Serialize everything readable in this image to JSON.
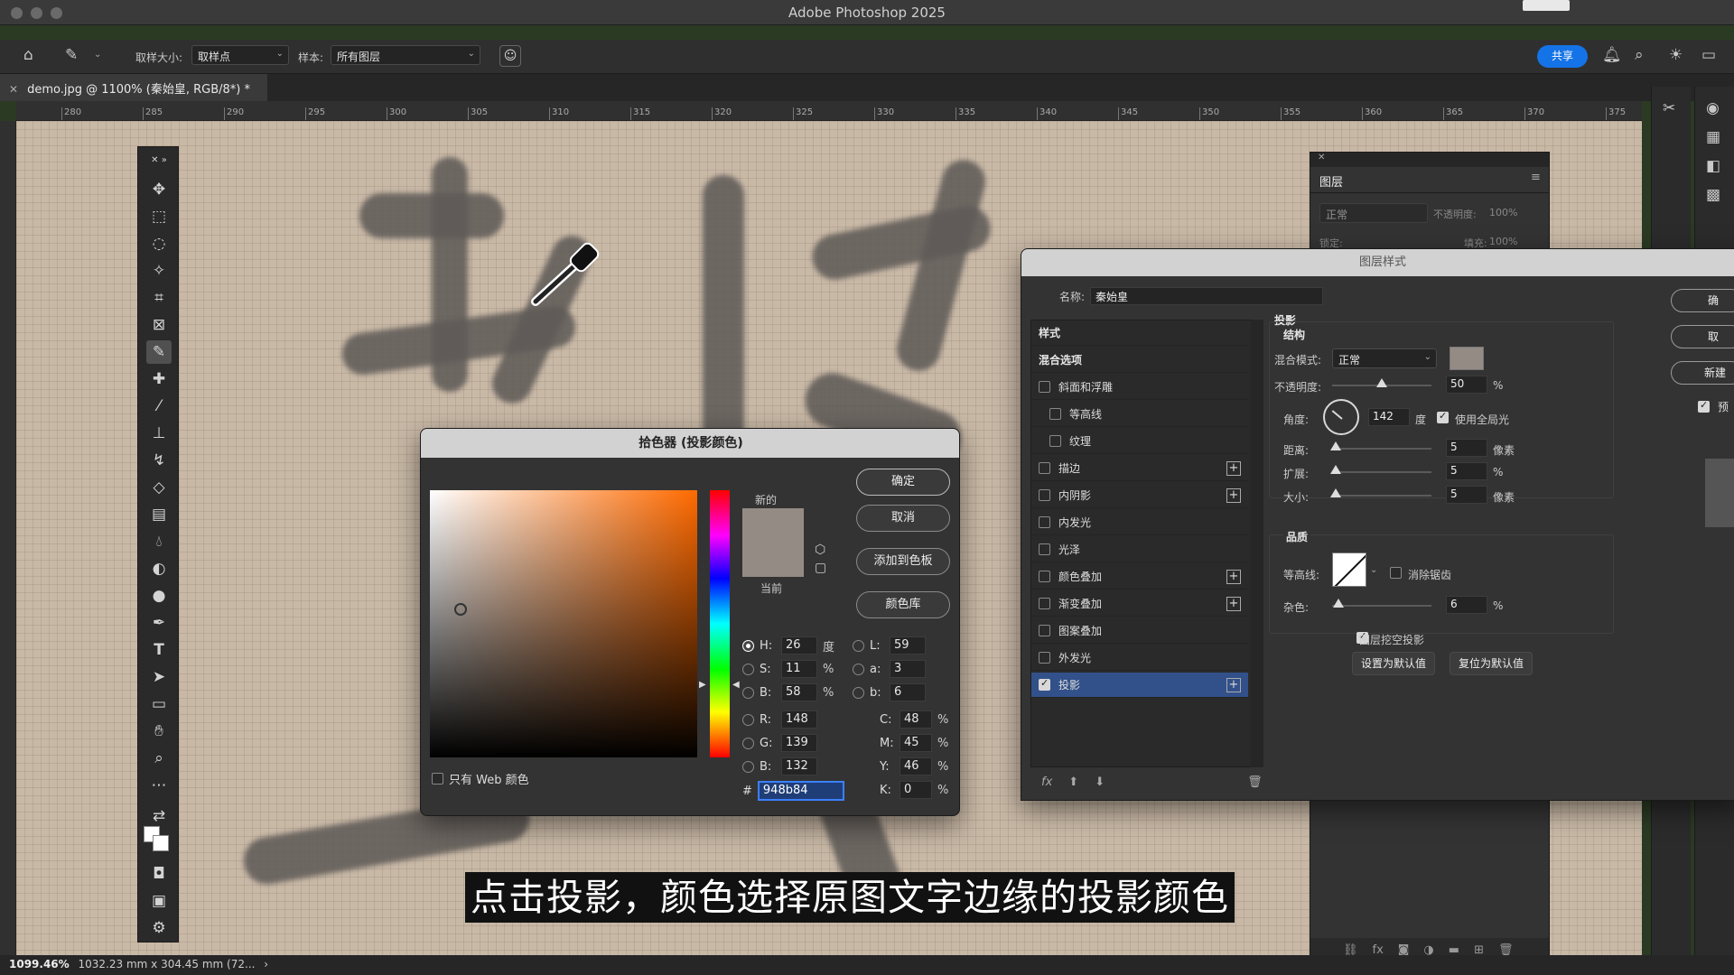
{
  "app": {
    "title": "Adobe Photoshop 2025"
  },
  "options_bar": {
    "sample_size_label": "取样大小:",
    "sample_size_value": "取样点",
    "sample_label": "样本:",
    "sample_value": "所有图层",
    "share_label": "共享"
  },
  "document": {
    "tab_title": "demo.jpg @ 1100% (秦始皇, RGB/8*) *",
    "ruler_ticks": [
      "280",
      "285",
      "290",
      "295",
      "300",
      "305",
      "310",
      "315",
      "320",
      "325",
      "330",
      "335",
      "340",
      "345",
      "350",
      "355",
      "360",
      "365",
      "370",
      "375"
    ]
  },
  "layers_panel": {
    "tab": "图层",
    "blend": "正常",
    "opacity_label": "不透明度:",
    "opacity_value": "100%",
    "lock_label": "锁定:",
    "fill_label": "填充:",
    "fill_value": "100%"
  },
  "color_picker": {
    "title": "拾色器 (投影颜色)",
    "new_label": "新的",
    "current_label": "当前",
    "new_color": "#948b84",
    "current_color": "#948b84",
    "buttons": {
      "ok": "确定",
      "cancel": "取消",
      "add_swatch": "添加到色板",
      "library": "颜色库"
    },
    "fields": {
      "H": {
        "label": "H:",
        "value": "26",
        "unit": "度"
      },
      "S": {
        "label": "S:",
        "value": "11",
        "unit": "%"
      },
      "B": {
        "label": "B:",
        "value": "58",
        "unit": "%"
      },
      "R": {
        "label": "R:",
        "value": "148"
      },
      "G": {
        "label": "G:",
        "value": "139"
      },
      "Bv": {
        "label": "B:",
        "value": "132"
      },
      "L": {
        "label": "L:",
        "value": "59"
      },
      "a": {
        "label": "a:",
        "value": "3"
      },
      "b": {
        "label": "b:",
        "value": "6"
      },
      "C": {
        "label": "C:",
        "value": "48",
        "unit": "%"
      },
      "M": {
        "label": "M:",
        "value": "45",
        "unit": "%"
      },
      "Y": {
        "label": "Y:",
        "value": "46",
        "unit": "%"
      },
      "K": {
        "label": "K:",
        "value": "0",
        "unit": "%"
      }
    },
    "hex_label": "#",
    "hex_value": "948b84",
    "web_only_label": "只有 Web 颜色"
  },
  "layer_style": {
    "title": "图层样式",
    "name_label": "名称:",
    "name_value": "秦始皇",
    "list": [
      {
        "label": "样式",
        "kind": "header"
      },
      {
        "label": "混合选项",
        "kind": "header"
      },
      {
        "label": "斜面和浮雕",
        "kind": "check"
      },
      {
        "label": "等高线",
        "kind": "subcheck"
      },
      {
        "label": "纹理",
        "kind": "subcheck"
      },
      {
        "label": "描边",
        "kind": "check",
        "plus": true
      },
      {
        "label": "内阴影",
        "kind": "check",
        "plus": true
      },
      {
        "label": "内发光",
        "kind": "check"
      },
      {
        "label": "光泽",
        "kind": "check"
      },
      {
        "label": "颜色叠加",
        "kind": "check",
        "plus": true
      },
      {
        "label": "渐变叠加",
        "kind": "check",
        "plus": true
      },
      {
        "label": "图案叠加",
        "kind": "check"
      },
      {
        "label": "外发光",
        "kind": "check"
      },
      {
        "label": "投影",
        "kind": "check",
        "plus": true,
        "checked": true,
        "selected": true
      }
    ],
    "shadow": {
      "section": "投影",
      "structure": "结构",
      "blend_label": "混合模式:",
      "blend_value": "正常",
      "shadow_color": "#948b84",
      "opacity_label": "不透明度:",
      "opacity_value": "50",
      "opacity_unit": "%",
      "angle_label": "角度:",
      "angle_value": "142",
      "angle_unit": "度",
      "global_light_label": "使用全局光",
      "distance_label": "距离:",
      "distance_value": "5",
      "distance_unit": "像素",
      "spread_label": "扩展:",
      "spread_value": "5",
      "spread_unit": "%",
      "size_label": "大小:",
      "size_value": "5",
      "size_unit": "像素",
      "quality": "品质",
      "contour_label": "等高线:",
      "antialias_label": "消除锯齿",
      "noise_label": "杂色:",
      "noise_value": "6",
      "noise_unit": "%",
      "knockout_label": "图层挖空投影",
      "set_default": "设置为默认值",
      "reset_default": "复位为默认值"
    },
    "side_buttons": [
      "确",
      "取",
      "新建",
      "预"
    ]
  },
  "status": {
    "zoom": "1099.46%",
    "info": "1032.23 mm x 304.45 mm (72..."
  },
  "subtitle": "点击投影，颜色选择原图文字边缘的投影颜色"
}
